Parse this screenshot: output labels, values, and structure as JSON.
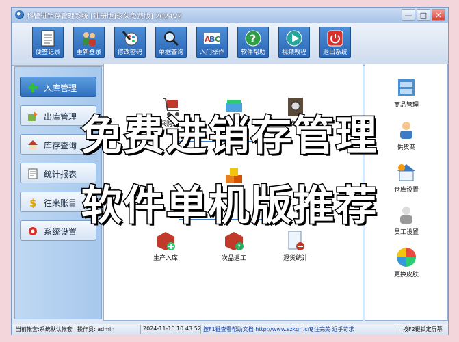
{
  "window": {
    "title": "科管进销存管理系统 [注册版]永久免费版] 2024V2"
  },
  "window_buttons": {
    "minimize": "—",
    "maximize": "□",
    "close": "✕"
  },
  "toolbar": [
    {
      "label": "便签记录",
      "icon": "notepad-icon"
    },
    {
      "label": "重新登录",
      "icon": "users-icon"
    },
    {
      "label": "修改密码",
      "icon": "pencil-palette-icon"
    },
    {
      "label": "单据查询",
      "icon": "magnifier-icon"
    },
    {
      "label": "入门操作",
      "icon": "abc-icon"
    },
    {
      "label": "软件帮助",
      "icon": "help-icon"
    },
    {
      "label": "视频教程",
      "icon": "play-icon"
    },
    {
      "label": "退出系统",
      "icon": "power-icon"
    }
  ],
  "sidebar": [
    {
      "label": "入库管理",
      "icon": "plus-icon",
      "active": true
    },
    {
      "label": "出库管理",
      "icon": "outbound-icon"
    },
    {
      "label": "库存查询",
      "icon": "house-icon"
    },
    {
      "label": "统计报表",
      "icon": "report-icon"
    },
    {
      "label": "往来账目",
      "icon": "dollar-icon"
    },
    {
      "label": "系统设置",
      "icon": "gear-icon"
    }
  ],
  "main_flow": [
    {
      "label": "采购入库",
      "icon": "cart-icon"
    },
    {
      "label": "",
      "icon": "scanner-icon"
    },
    {
      "label": "入库统计",
      "icon": "safe-icon"
    },
    {
      "label": "",
      "icon": "boxes-icon"
    },
    {
      "label": "生产入库",
      "icon": "box-plus-icon"
    },
    {
      "label": "次品返工",
      "icon": "box-question-icon"
    },
    {
      "label": "退货统计",
      "icon": "document-minus-icon"
    }
  ],
  "right_panel": [
    {
      "label": "商品管理",
      "icon": "cabinet-icon"
    },
    {
      "label": "供货商",
      "icon": "supplier-icon"
    },
    {
      "label": "仓库设置",
      "icon": "warehouse-gear-icon"
    },
    {
      "label": "员工设置",
      "icon": "staff-icon"
    },
    {
      "label": "更换皮肤",
      "icon": "color-wheel-icon"
    }
  ],
  "status": {
    "account": "当前帐套:系统默认帐套",
    "operator": "操作员: admin",
    "datetime": "2024-11-16 10:43:52",
    "help": "按F1键查看帮助文档 http://www.szkgrj.cn/",
    "slogan": "专注完美 近乎苛求",
    "lock": "按F2键锁定屏幕"
  },
  "overlay": {
    "line1": "免费进销存管理",
    "line2": "软件单机版推荐"
  },
  "colors": {
    "accent": "#2a66b4",
    "flow_line": "#3a7fd0",
    "background": "#f3d6dc"
  }
}
